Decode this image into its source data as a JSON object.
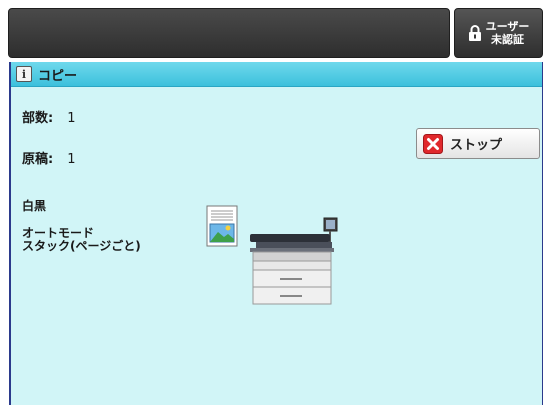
{
  "header": {
    "user_button": {
      "line1": "ユーザー",
      "line2": "未認証",
      "icon": "lock-icon"
    }
  },
  "panel": {
    "title": "コピー",
    "info_icon_glyph": "i",
    "copies": {
      "label": "部数:",
      "value": "1"
    },
    "originals": {
      "label": "原稿:",
      "value": "1"
    },
    "stop_button": {
      "label": "ストップ",
      "icon": "stop-x-icon"
    },
    "status": {
      "color_mode": "白黒",
      "mode_line1": "オートモード",
      "mode_line2": "スタック(ページごと)"
    },
    "colors": {
      "panel_bg": "#d1f5f7",
      "header_bg": "#3cc0dc",
      "stop_icon": "#e0282c"
    }
  }
}
